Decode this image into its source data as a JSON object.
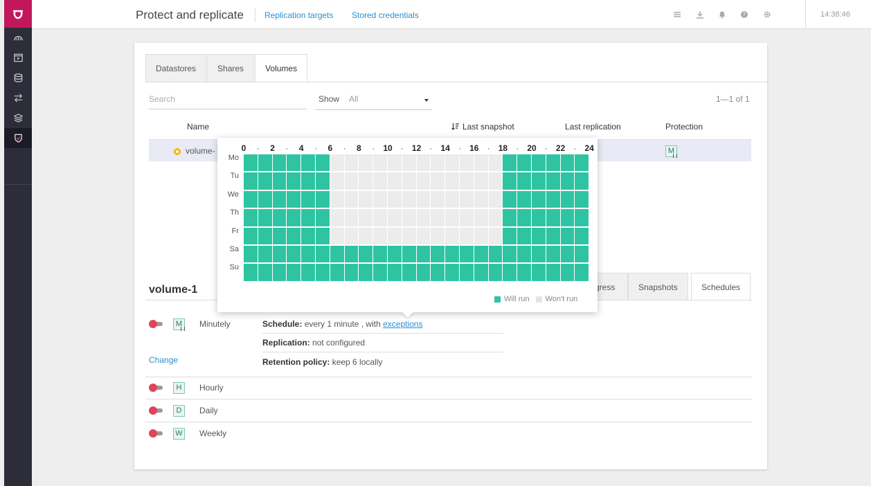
{
  "header": {
    "title": "Protect and replicate",
    "links": [
      "Replication targets",
      "Stored credentials"
    ],
    "time": "14:38:46"
  },
  "tabs": [
    "Datastores",
    "Shares",
    "Volumes"
  ],
  "active_tab": "Volumes",
  "filter": {
    "search_placeholder": "Search",
    "show_label": "Show",
    "show_value": "All",
    "pager": "1—1 of 1"
  },
  "table": {
    "columns": [
      "Name",
      "Last snapshot",
      "Last replication",
      "Protection"
    ],
    "rows": [
      {
        "name": "volume-",
        "protection_badge": "M"
      }
    ]
  },
  "volume": {
    "title": "volume-1",
    "tabs": [
      "gress",
      "Snapshots",
      "Schedules"
    ],
    "active_tab": "Schedules"
  },
  "schedules": [
    {
      "badge": "M",
      "label": "Minutely"
    },
    {
      "badge": "H",
      "label": "Hourly"
    },
    {
      "badge": "D",
      "label": "Daily"
    },
    {
      "badge": "W",
      "label": "Weekly"
    }
  ],
  "details": {
    "schedule_label": "Schedule:",
    "schedule_text": "every 1 minute , with",
    "schedule_link": "exceptions",
    "replication_label": "Replication:",
    "replication_text": "not configured",
    "retention_label": "Retention policy:",
    "retention_text": "keep 6 locally",
    "change": "Change"
  },
  "heatmap": {
    "hour_labels": [
      "0",
      "2",
      "4",
      "6",
      "8",
      "10",
      "12",
      "14",
      "16",
      "18",
      "20",
      "22",
      "24"
    ],
    "days": [
      "Mo",
      "Tu",
      "We",
      "Th",
      "Fr",
      "Sa",
      "Su"
    ],
    "on_hours_weekday": [
      0,
      1,
      2,
      3,
      4,
      5,
      18,
      19,
      20,
      21,
      22,
      23
    ],
    "on_hours_weekend": "all",
    "legend_on": "Will run",
    "legend_off": "Won't run",
    "colors": {
      "on": "#2ec4a1",
      "off": "#ececec"
    }
  }
}
